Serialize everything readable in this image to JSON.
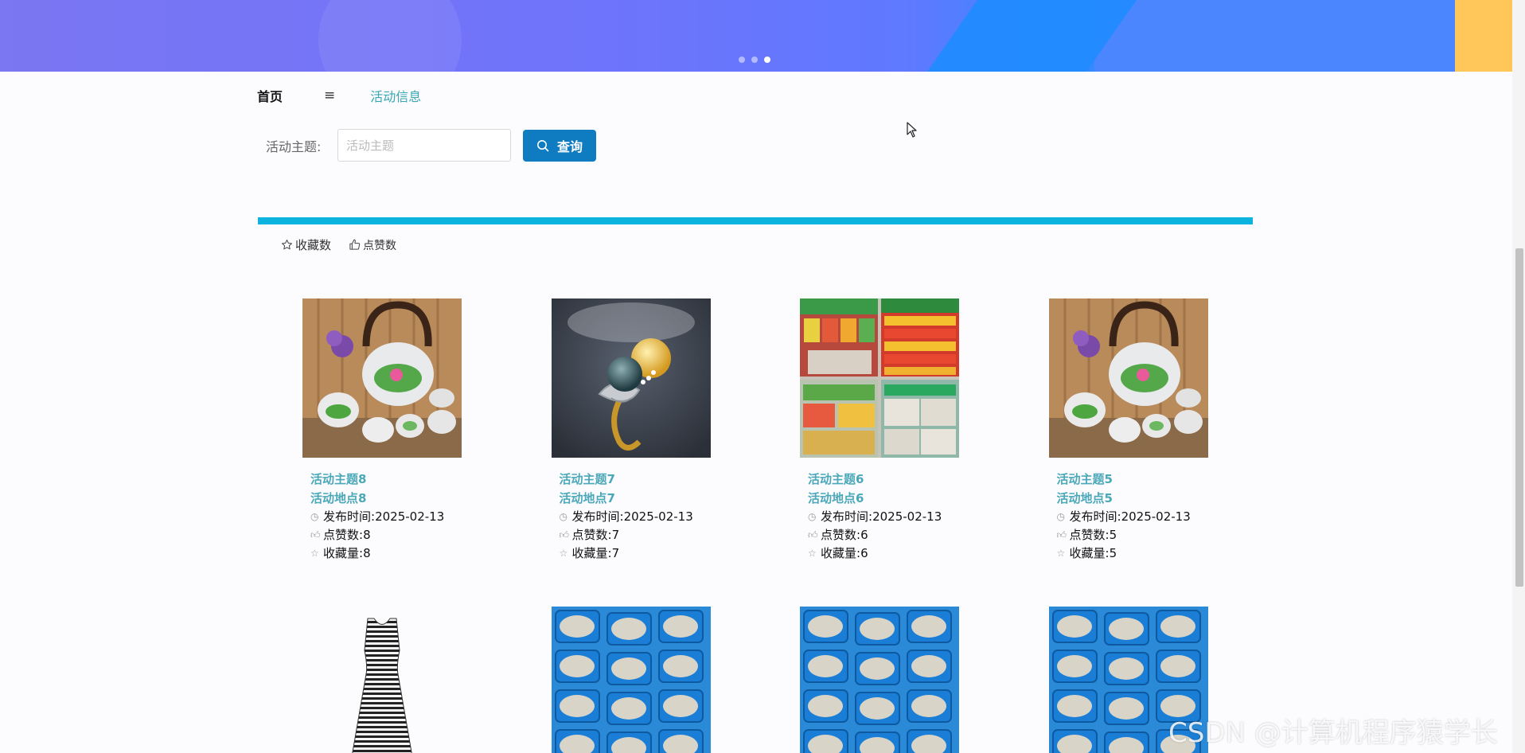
{
  "breadcrumb": {
    "home": "首页",
    "separator": "≡",
    "current": "活动信息"
  },
  "search": {
    "label": "活动主题:",
    "placeholder": "活动主题",
    "value": "",
    "button_label": "查询"
  },
  "sort": {
    "favorites": "收藏数",
    "likes": "点赞数"
  },
  "meta_labels": {
    "publish": "发布时间:",
    "likes": "点赞数:",
    "favorites": "收藏量:"
  },
  "cards": [
    {
      "title": "活动主题8",
      "place": "活动地点8",
      "date": "2025-02-13",
      "likes": "8",
      "favorites": "8",
      "image": "teapot-set"
    },
    {
      "title": "活动主题7",
      "place": "活动地点7",
      "date": "2025-02-13",
      "likes": "7",
      "favorites": "7",
      "image": "pearl-ring"
    },
    {
      "title": "活动主题6",
      "place": "活动地点6",
      "date": "2025-02-13",
      "likes": "6",
      "favorites": "6",
      "image": "supermarket-shelves"
    },
    {
      "title": "活动主题5",
      "place": "活动地点5",
      "date": "2025-02-13",
      "likes": "5",
      "favorites": "5",
      "image": "teapot-set"
    },
    {
      "image": "striped-dress"
    },
    {
      "image": "fish-trays"
    },
    {
      "image": "fish-trays"
    },
    {
      "image": "fish-trays"
    }
  ],
  "watermark": "CSDN @计算机程序猿学长",
  "colors": {
    "accent": "#0f7cc2",
    "divider": "#0bb3de",
    "link": "#4aa8b8"
  }
}
